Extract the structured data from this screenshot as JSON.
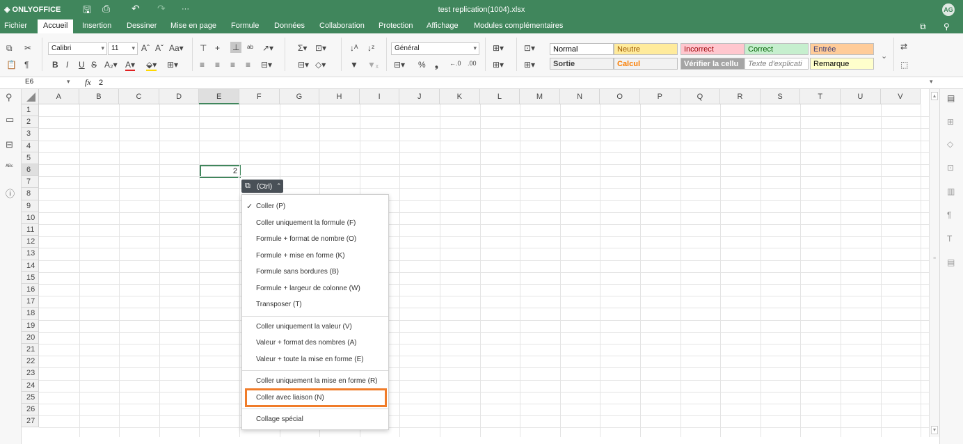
{
  "app": {
    "logo": "ONLYOFFICE",
    "document_title": "test replication(1004).xlsx",
    "avatar": "AG"
  },
  "menu": {
    "tabs": [
      "Fichier",
      "Accueil",
      "Insertion",
      "Dessiner",
      "Mise en page",
      "Formule",
      "Données",
      "Collaboration",
      "Protection",
      "Affichage",
      "Modules complémentaires"
    ],
    "active": "Accueil"
  },
  "toolbar": {
    "font_name": "Calibri",
    "font_size": "11",
    "number_format": "Général",
    "cell_styles": [
      {
        "label": "Normal",
        "bg": "#ffffff",
        "color": "#000000"
      },
      {
        "label": "Neutre",
        "bg": "#ffeb9c",
        "color": "#9c5700"
      },
      {
        "label": "Incorrect",
        "bg": "#ffc7ce",
        "color": "#9c0006"
      },
      {
        "label": "Correct",
        "bg": "#c6efce",
        "color": "#006100"
      },
      {
        "label": "Entrée",
        "bg": "#ffcc99",
        "color": "#3f3f76"
      },
      {
        "label": "Sortie",
        "bg": "#f2f2f2",
        "color": "#3f3f3f"
      },
      {
        "label": "Calcul",
        "bg": "#f2f2f2",
        "color": "#fa7d00"
      },
      {
        "label": "Vérifier la cellu",
        "bg": "#a5a5a5",
        "color": "#ffffff"
      },
      {
        "label": "Texte d'explicati",
        "bg": "#ffffff",
        "color": "#7f7f7f"
      },
      {
        "label": "Remarque",
        "bg": "#ffffcc",
        "color": "#000000"
      }
    ]
  },
  "formula_bar": {
    "cell_ref": "E6",
    "fx": "fx",
    "value": "2"
  },
  "sheet": {
    "columns": [
      "A",
      "B",
      "C",
      "D",
      "E",
      "F",
      "G",
      "H",
      "I",
      "J",
      "K",
      "L",
      "M",
      "N",
      "O",
      "P",
      "Q",
      "R",
      "S",
      "T",
      "U",
      "V"
    ],
    "selected_column": "E",
    "rows": [
      "1",
      "2",
      "3",
      "4",
      "5",
      "6",
      "7",
      "8",
      "9",
      "10",
      "11",
      "12",
      "13",
      "14",
      "15",
      "16",
      "17",
      "18",
      "19",
      "20",
      "21",
      "22",
      "23",
      "24",
      "25",
      "26",
      "27"
    ],
    "selected_row": "6",
    "active_cell_value": "2"
  },
  "paste_button": {
    "label": "(Ctrl)"
  },
  "paste_menu": {
    "groups": [
      [
        "Coller (P)",
        "Coller uniquement la formule (F)",
        "Formule + format de nombre (O)",
        "Formule + mise en forme (K)",
        "Formule sans bordures (B)",
        "Formule + largeur de colonne (W)",
        "Transposer (T)"
      ],
      [
        "Coller uniquement la valeur (V)",
        "Valeur + format des nombres (A)",
        "Valeur + toute la mise en forme (E)"
      ],
      [
        "Coller uniquement la mise en forme (R)",
        "Coller avec liaison (N)"
      ],
      [
        "Collage spécial"
      ]
    ],
    "checked": "Coller (P)",
    "highlighted": "Coller avec liaison (N)",
    "highlight_color": "#f07c2a"
  },
  "colors": {
    "brand": "#40865c"
  }
}
